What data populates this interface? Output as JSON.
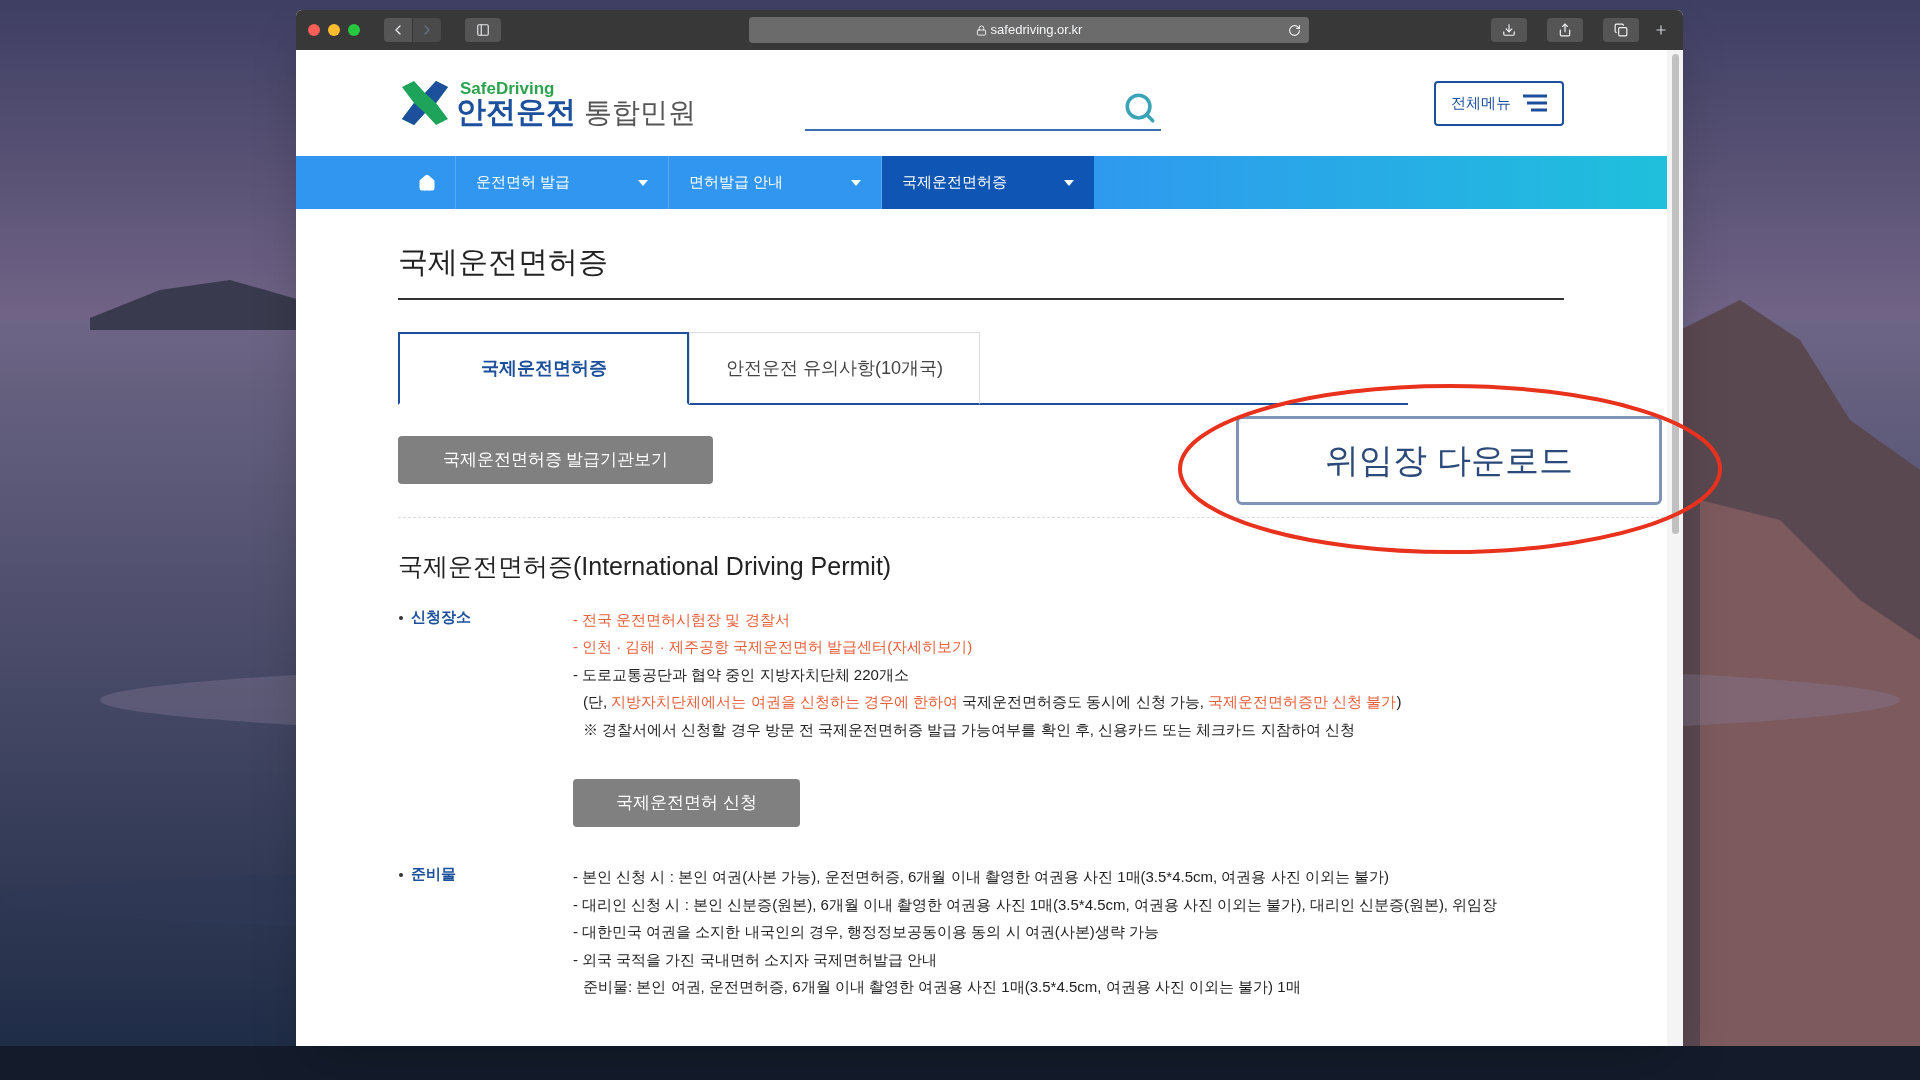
{
  "browser": {
    "url": "safedriving.or.kr"
  },
  "header": {
    "logo_en": "SafeDriving",
    "logo_ko": "안전운전",
    "logo_suffix": "통합민원",
    "menu_button": "전체메뉴"
  },
  "nav": [
    {
      "label": "운전면허 발급",
      "selected": false
    },
    {
      "label": "면허발급 안내",
      "selected": false
    },
    {
      "label": "국제운전면허증",
      "selected": true
    }
  ],
  "page_title": "국제운전면허증",
  "tabs": [
    {
      "label": "국제운전면허증",
      "selected": true
    },
    {
      "label": "안전운전 유의사항(10개국)",
      "selected": false
    }
  ],
  "issuer_button": "국제운전면허증 발급기관보기",
  "download_button": "위임장 다운로드",
  "section_title": "국제운전면허증(International Driving Permit)",
  "sections": [
    {
      "label": "신청장소",
      "lines": [
        {
          "indent": false,
          "segments": [
            {
              "text": "- 전국 운전면허시험장 및 경찰서",
              "highlight": true
            }
          ]
        },
        {
          "indent": false,
          "segments": [
            {
              "text": "- 인천 · 김해 · 제주공항 국제운전면허 발급센터(자세히보기)",
              "highlight": true
            }
          ]
        },
        {
          "indent": false,
          "segments": [
            {
              "text": "- 도로교통공단과 협약 중인 지방자치단체 220개소",
              "highlight": false
            }
          ]
        },
        {
          "indent": true,
          "segments": [
            {
              "text": "(단, ",
              "highlight": false
            },
            {
              "text": "지방자치단체에서는 여권을 신청하는 경우에 한하여",
              "highlight": true
            },
            {
              "text": " 국제운전면허증도 동시에 신청 가능, ",
              "highlight": false
            },
            {
              "text": "국제운전면허증만 신청 불가",
              "highlight": true
            },
            {
              "text": ")",
              "highlight": false
            }
          ]
        },
        {
          "indent": true,
          "segments": [
            {
              "text": "※ 경찰서에서 신청할 경우 방문 전 국제운전면허증 발급 가능여부를 확인 후, 신용카드 또는 체크카드 지참하여 신청",
              "highlight": false
            }
          ]
        }
      ],
      "button": "국제운전면허 신청"
    },
    {
      "label": "준비물",
      "lines": [
        {
          "indent": false,
          "segments": [
            {
              "text": "- 본인 신청 시 : 본인 여권(사본 가능), 운전면허증, 6개월 이내 촬영한 여권용 사진 1매(3.5*4.5cm, 여권용 사진 이외는 불가)",
              "highlight": false
            }
          ]
        },
        {
          "indent": false,
          "segments": [
            {
              "text": "- 대리인 신청 시 : 본인 신분증(원본), 6개월 이내 촬영한 여권용 사진 1매(3.5*4.5cm, 여권용 사진 이외는 불가), 대리인 신분증(원본), 위임장",
              "highlight": false
            }
          ]
        },
        {
          "indent": false,
          "segments": [
            {
              "text": "- 대한민국 여권을 소지한 내국인의 경우, 행정정보공동이용 동의 시 여권(사본)생략 가능",
              "highlight": false
            }
          ]
        },
        {
          "indent": false,
          "segments": [
            {
              "text": "- 외국 국적을 가진 국내면허 소지자 국제면허발급 안내",
              "highlight": false
            }
          ]
        },
        {
          "indent": true,
          "segments": [
            {
              "text": "준비물: 본인 여권, 운전면허증, 6개월 이내 촬영한 여권용 사진 1매(3.5*4.5cm, 여권용 사진 이외는 불가) 1매",
              "highlight": false
            }
          ]
        }
      ]
    }
  ]
}
